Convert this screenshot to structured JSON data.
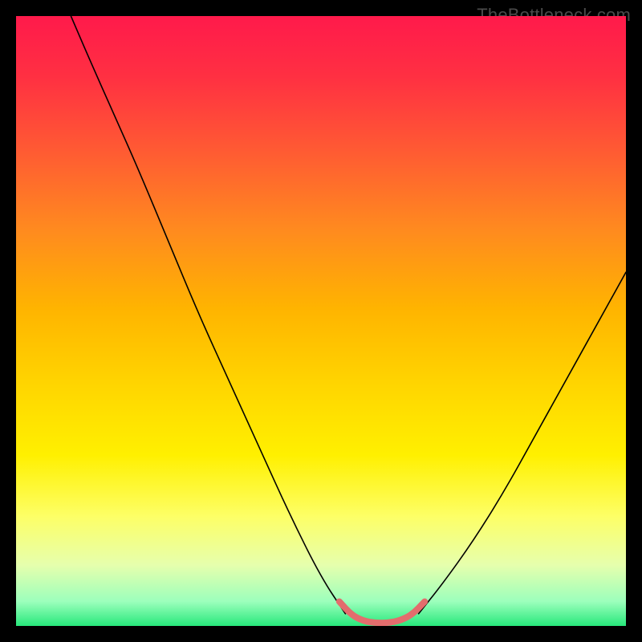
{
  "watermark": "TheBottleneck.com",
  "chart_data": {
    "type": "line",
    "title": "",
    "xlabel": "",
    "ylabel": "",
    "xlim": [
      0,
      100
    ],
    "ylim": [
      0,
      100
    ],
    "grid": false,
    "legend": false,
    "annotations": [],
    "background_gradient": {
      "stops": [
        {
          "offset": 0.0,
          "color": "#ff1a4b"
        },
        {
          "offset": 0.1,
          "color": "#ff3042"
        },
        {
          "offset": 0.22,
          "color": "#ff5a33"
        },
        {
          "offset": 0.35,
          "color": "#ff8a1f"
        },
        {
          "offset": 0.48,
          "color": "#ffb400"
        },
        {
          "offset": 0.6,
          "color": "#ffd400"
        },
        {
          "offset": 0.72,
          "color": "#fff000"
        },
        {
          "offset": 0.82,
          "color": "#fdff66"
        },
        {
          "offset": 0.9,
          "color": "#e6ffad"
        },
        {
          "offset": 0.96,
          "color": "#9cffbc"
        },
        {
          "offset": 1.0,
          "color": "#27e87b"
        }
      ]
    },
    "series": [
      {
        "name": "left-curve",
        "color": "#000000",
        "stroke_width": 1.6,
        "x": [
          9,
          12,
          16,
          20,
          25,
          30,
          35,
          40,
          45,
          50,
          54
        ],
        "values": [
          100,
          93,
          84,
          75,
          63,
          51,
          40,
          29,
          18,
          8,
          2
        ]
      },
      {
        "name": "right-curve",
        "color": "#000000",
        "stroke_width": 1.6,
        "x": [
          66,
          70,
          75,
          80,
          85,
          90,
          95,
          100
        ],
        "values": [
          2,
          7,
          14,
          22,
          31,
          40,
          49,
          58
        ]
      },
      {
        "name": "highlight-segment",
        "color": "#e36d6d",
        "stroke_width": 8,
        "x": [
          53,
          55,
          57,
          59,
          61,
          63,
          65,
          67
        ],
        "values": [
          4.0,
          1.8,
          0.8,
          0.5,
          0.5,
          0.9,
          1.9,
          4.0
        ]
      }
    ]
  }
}
